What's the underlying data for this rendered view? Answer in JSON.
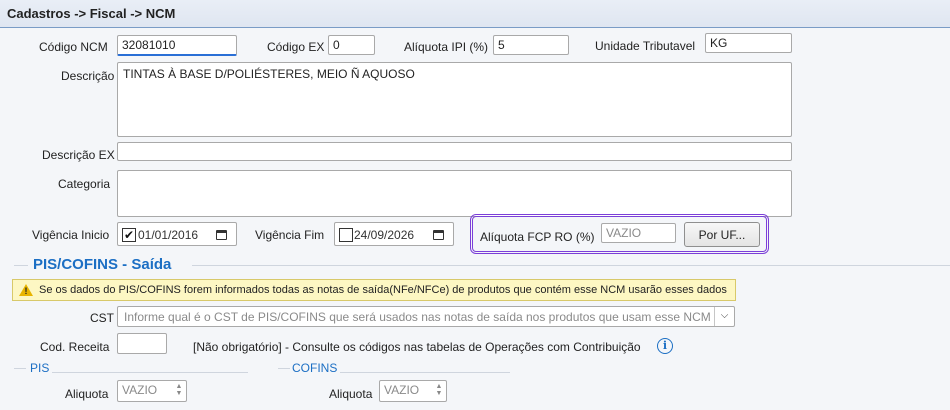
{
  "header": {
    "breadcrumb": "Cadastros -> Fiscal -> NCM"
  },
  "form": {
    "codigo_ncm": {
      "label": "Código NCM",
      "value": "32081010"
    },
    "codigo_ex": {
      "label": "Código EX",
      "value": "0"
    },
    "aliquota_ipi": {
      "label": "Alíquota IPI (%)",
      "value": "5"
    },
    "unidade_tributavel": {
      "label": "Unidade Tributavel",
      "value": "KG"
    },
    "descricao": {
      "label": "Descrição",
      "value": "TINTAS À BASE D/POLIÉSTERES, MEIO Ñ AQUOSO"
    },
    "descricao_ex": {
      "label": "Descrição EX",
      "value": ""
    },
    "categoria": {
      "label": "Categoria",
      "value": ""
    },
    "vigencia_inicio": {
      "label": "Vigência Inicio",
      "value": "01/01/2016",
      "checked_mark": "✔"
    },
    "vigencia_fim": {
      "label": "Vigência Fim",
      "value": "24/09/2026"
    },
    "aliquota_fcp": {
      "label": "Alíquota FCP RO (%)",
      "placeholder": "VAZIO"
    },
    "por_uf_button": "Por UF..."
  },
  "pis_cofins": {
    "title": "PIS/COFINS  - Saída",
    "warning": "Se os dados do PIS/COFINS  forem informados todas as notas de saída(NFe/NFCe) de produtos que contém esse NCM usarão esses dados",
    "cst": {
      "label": "CST",
      "placeholder": "Informe qual é o CST de PIS/COFINS que será usados nas notas de saída nos produtos que usam esse NCM"
    },
    "cod_receita": {
      "label": "Cod. Receita",
      "value": "",
      "hint": "[Não obrigatório] - Consulte os códigos nas tabelas de Operações com Contribuição"
    },
    "pis": {
      "title": "PIS",
      "aliquota_label": "Aliquota",
      "placeholder": "VAZIO"
    },
    "cofins": {
      "title": "COFINS",
      "aliquota_label": "Aliquota",
      "placeholder": "VAZIO"
    }
  },
  "colors": {
    "accent": "#1c6fc4",
    "highlight_border": "#7b3fd8",
    "warning_bg": "#fdf7c3"
  }
}
